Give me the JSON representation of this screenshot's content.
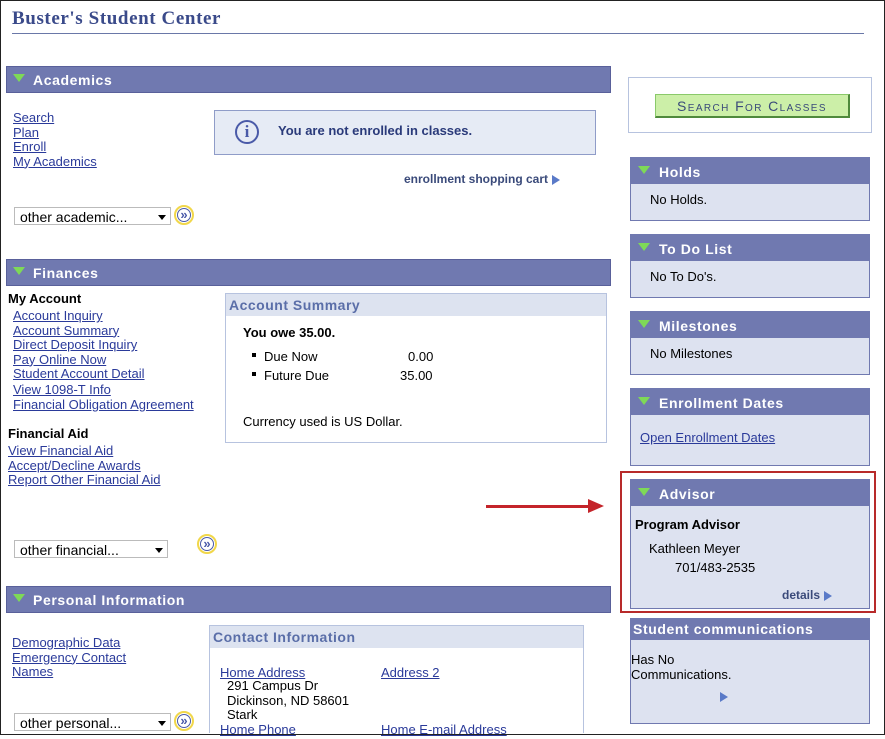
{
  "page": {
    "title": "Buster's Student Center"
  },
  "academics": {
    "header": "Academics",
    "links": [
      "Search",
      "Plan",
      "Enroll",
      "My Academics"
    ],
    "message": "You are not enrolled in classes.",
    "cart_link": "enrollment shopping cart",
    "dropdown": "other academic..."
  },
  "search_button": {
    "first": "S",
    "rest": "earch ",
    "first2": "F",
    "rest2": "or ",
    "first3": "C",
    "rest3": "lasses"
  },
  "finances": {
    "header": "Finances",
    "my_account_label": "My Account",
    "account_links": [
      "Account Inquiry",
      "Account Summary",
      "Direct Deposit Inquiry",
      "Pay Online Now",
      "Student Account Detail",
      "View 1098-T Info",
      "Financial Obligation Agreement"
    ],
    "financial_aid_label": "Financial Aid",
    "aid_links": [
      "View Financial Aid",
      "Accept/Decline Awards",
      "Report Other Financial Aid"
    ],
    "dropdown": "other financial...",
    "summary": {
      "title": "Account Summary",
      "owe": "You owe 35.00.",
      "rows": [
        {
          "label": "Due Now",
          "amount": "0.00"
        },
        {
          "label": "Future Due",
          "amount": "35.00"
        }
      ],
      "currency": "Currency used is US Dollar."
    }
  },
  "personal": {
    "header": "Personal Information",
    "links": [
      "Demographic Data",
      "Emergency Contact",
      "Names"
    ],
    "dropdown": "other personal...",
    "contact": {
      "title": "Contact Information",
      "home_address_label": "Home Address",
      "address2_label": "Address 2",
      "address_lines": [
        "291 Campus Dr",
        "Dickinson, ND 58601",
        "Stark"
      ],
      "home_phone_label": "Home Phone",
      "home_email_label": "Home E-mail Address"
    }
  },
  "holds": {
    "header": "Holds",
    "text": "No Holds."
  },
  "todo": {
    "header": "To Do List",
    "text": "No To Do's."
  },
  "milestones": {
    "header": "Milestones",
    "text": "No Milestones"
  },
  "enrollment_dates": {
    "header": "Enrollment Dates",
    "link": "Open Enrollment Dates"
  },
  "advisor": {
    "header": "Advisor",
    "role": "Program Advisor",
    "name": "Kathleen Meyer",
    "phone": "701/483-2535",
    "details": "details"
  },
  "communications": {
    "header": "Student communications",
    "text": "Has No Communications."
  },
  "colors": {
    "header_bg": "#7079b0",
    "box_bg": "#dde2f0",
    "link": "#2a3a9a",
    "highlight": "#b82a2a",
    "button_bg": "#ccefa8"
  }
}
